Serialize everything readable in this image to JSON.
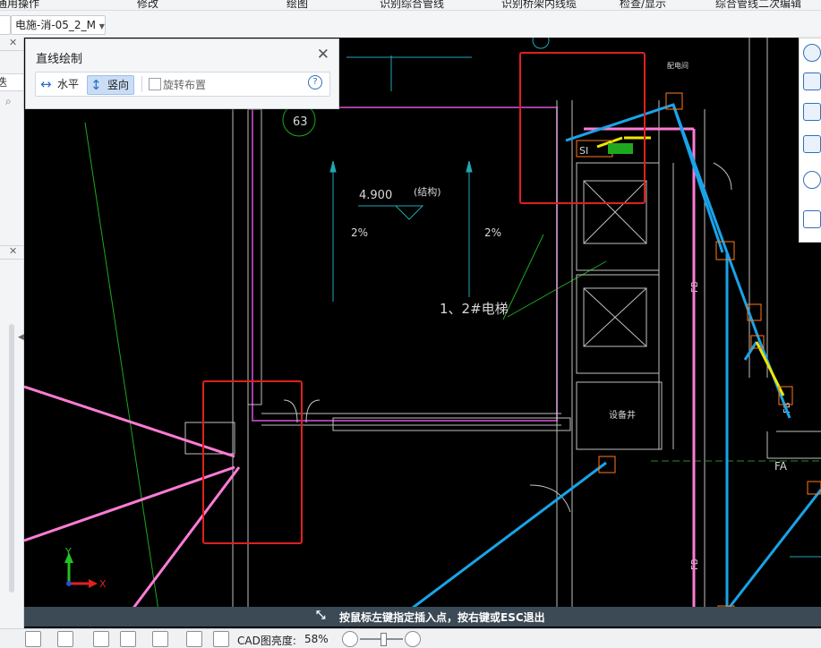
{
  "ribbon": {
    "items": [
      "通用操作",
      "修改",
      "绘图",
      "识别综合管线",
      "识别桥架内线缆",
      "检查/显示",
      "综合管线二次编辑"
    ]
  },
  "tabs": {
    "current_file": "电施-消-05_2_M"
  },
  "dialog": {
    "title": "直线绘制",
    "horizontal_label": "水平",
    "vertical_label": "竖向",
    "rotate_label": "旋转布置",
    "help": "?"
  },
  "drawing": {
    "number_label": "63",
    "elevation": "4.900",
    "elevation_note": "(结构)",
    "slope_left": "2%",
    "slope_right": "2%",
    "elevator_label": "1、2#电梯",
    "room_label": "设备井",
    "top_label": "配电间",
    "fb_label_1": "FB",
    "fb_label_2": "FB",
    "fb_label_3": "FB",
    "fa_label": "FA",
    "tag_label": "SI",
    "axis_x": "X",
    "axis_y": "Y"
  },
  "status_bar": {
    "text": "按鼠标左键指定插入点，按右键或ESC退出"
  },
  "bottom_toolbar": {
    "brightness_label": "CAD图亮度:",
    "brightness_value": "58%"
  },
  "colors": {
    "pipe_blue": "#1aa3e8",
    "pink_line": "#ff7bd6",
    "highlight_red": "#e02020",
    "wall_purple": "#a040a0",
    "teal": "#22a6b3",
    "yellow": "#f2e600"
  }
}
